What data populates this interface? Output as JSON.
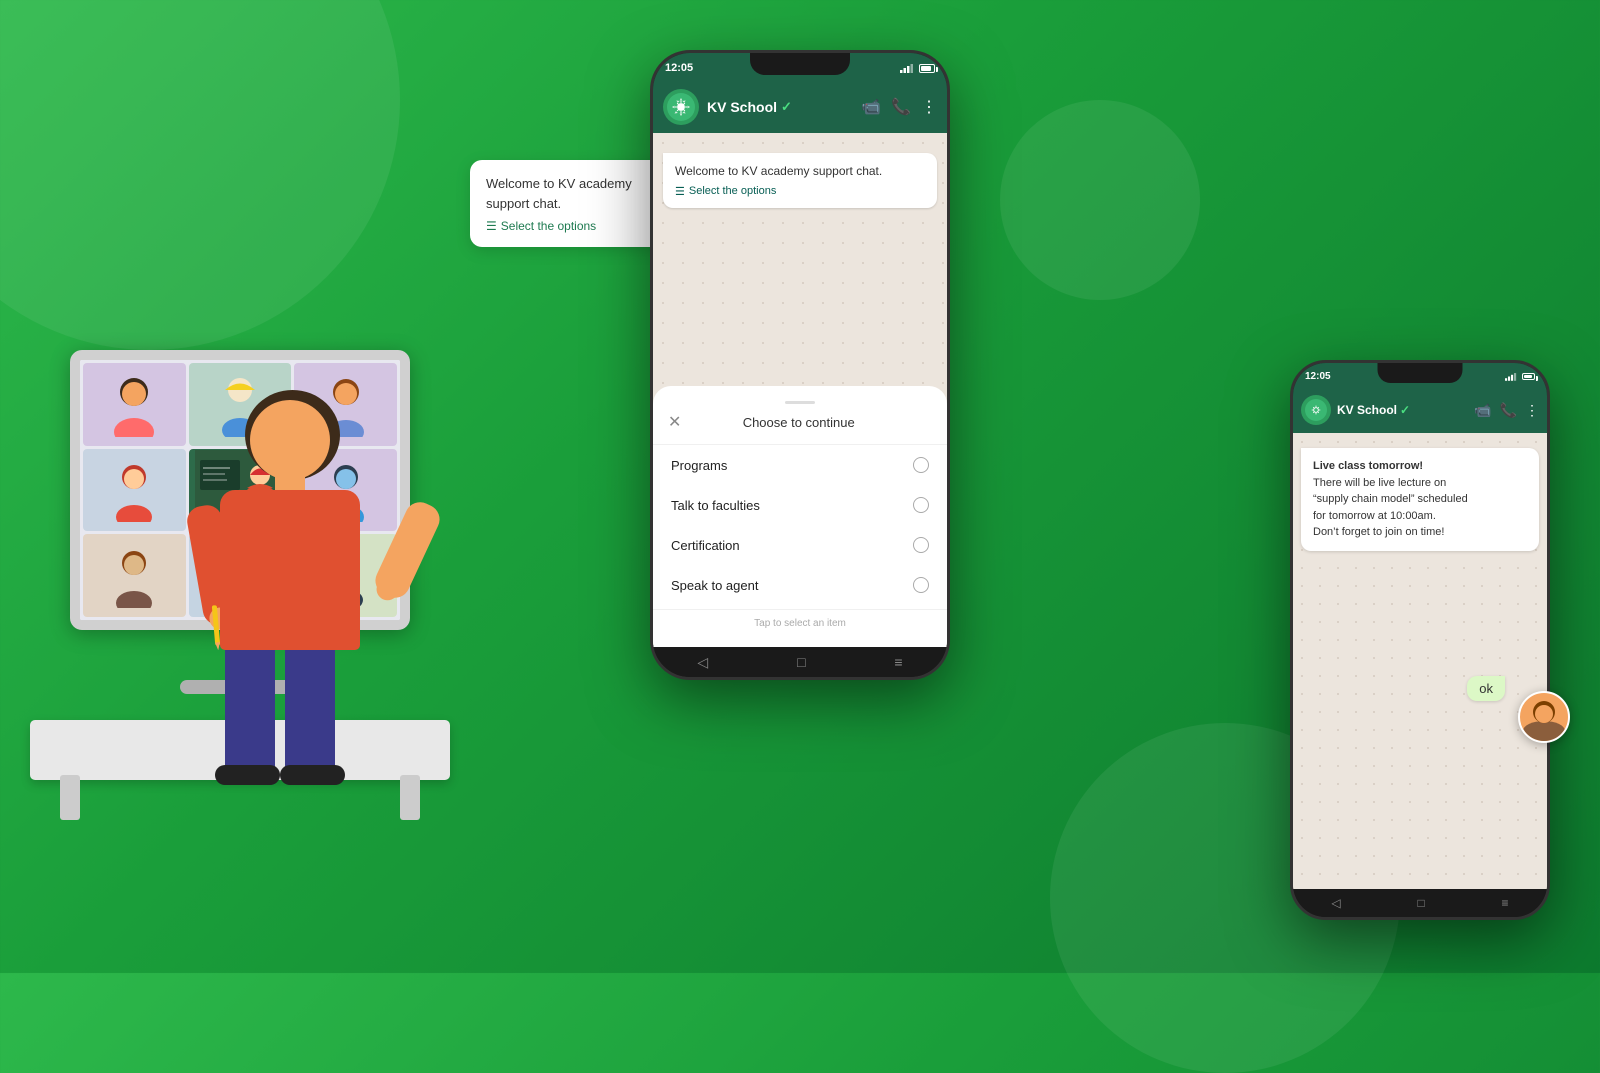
{
  "background": {
    "color_start": "#2db84b",
    "color_end": "#0d7a2e"
  },
  "phone_center": {
    "statusbar": {
      "time": "12:05",
      "signal": "signal",
      "battery": "battery"
    },
    "header": {
      "name": "KV School",
      "verified": "✓"
    },
    "welcome_bubble": {
      "text": "Welcome to KV academy support chat.",
      "link": "Select the options"
    },
    "choice_sheet": {
      "title": "Choose to continue",
      "items": [
        {
          "label": "Programs"
        },
        {
          "label": "Talk to faculties"
        },
        {
          "label": "Certification"
        },
        {
          "label": "Speak to agent"
        }
      ],
      "footer": "Tap to select an item"
    }
  },
  "phone_right": {
    "statusbar": {
      "time": "12:05"
    },
    "header": {
      "name": "KV School",
      "verified": "✓"
    },
    "notification": {
      "line1": "Live class tomorrow!",
      "line2": "There will be live lecture on",
      "line3": "“supply chain model” scheduled",
      "line4": "for tomorrow at 10:00am.",
      "line5": "Don’t forget to join on time!"
    },
    "reply": "ok"
  },
  "speech_bubble": {
    "text": "Welcome to KV academy support chat.",
    "link": "Select the options"
  },
  "icons": {
    "list_icon": "☰",
    "back_arrow": "‹",
    "close_x": "×",
    "nav_back": "◁",
    "nav_home": "□",
    "nav_recent": "≡"
  }
}
